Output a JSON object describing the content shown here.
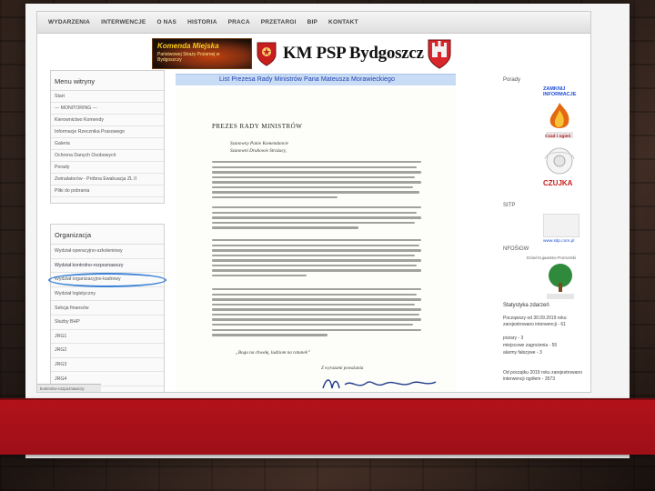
{
  "topnav": {
    "items": [
      "WYDARZENIA",
      "INTERWENCJE",
      "O NAS",
      "HISTORIA",
      "PRACA",
      "PRZETARGI",
      "BIP",
      "KONTAKT"
    ]
  },
  "banner": {
    "box_title": "Komenda Miejska",
    "box_sub": "Państwowej Straży Pożarnej w Bydgoszczy",
    "title": "KM PSP Bydgoszcz"
  },
  "menu": {
    "title": "Menu witryny",
    "items": [
      "Start",
      "--- MONITORING ---",
      "Kierownictwo Komendy",
      "Informacje Rzecznika Prasowego",
      "Galeria",
      "Ochrona Danych Osobowych",
      "Porady",
      "Zwinalatorów - Próbna Ewakuacja ZL II",
      "Pliki do pobrania"
    ]
  },
  "org": {
    "title": "Organizacja",
    "items": [
      "Wydział operacyjno-szkoleniowy",
      "Wydział kontrolno-rozpoznawczy",
      "Wydział organizacyjno-kadrowy",
      "Wydział logistyczny",
      "Sekcja finansów",
      "Służby BHP",
      "JRG1",
      "JRG2",
      "JRG3",
      "JRG4"
    ],
    "status": "kontrolno-rozpoznawczy"
  },
  "document": {
    "heading": "List Prezesa Rady Ministrów Pana Mateusza Morawieckiego",
    "letter_title": "PREZES RADY MINISTRÓW",
    "greeting1": "Szanowny Panie Komendancie",
    "greeting2": "Szanowni Druhowie Strażacy,",
    "closing_quote": "„Bogu na chwałę, ludziom na ratunek”",
    "closing": "Z wyrazami poważania"
  },
  "right": {
    "porady": "Porady",
    "zamknij": "ZAMKNIJ INFORMACJE",
    "czad_label": "Czad i ogień",
    "czujka_label": "CZUJKA",
    "sitp": "SITP",
    "sitp_link": "www.sitp.com.pl",
    "sitp_region": "Dział Kujawsko-Pomorski",
    "nfosigw": "NFOŚiGW",
    "stats_title": "Statystyka zdarzeń",
    "stats1": "Począwszy od 30.09.2019 roku zarejestrowano interwencji - 61",
    "stats2a": "pożary - 3",
    "stats2b": "miejscowe zagrożenia - 55",
    "stats2c": "alarmy fałszywe - 3",
    "stats3": "Od początku 2019 roku zarejestrowano interwencji ogółem - 3573"
  },
  "colors": {
    "accent_red": "#b3121b",
    "link_blue": "#1d4ed8",
    "doc_bar": "#c9dcf5",
    "highlight_oval": "#3b82d6"
  }
}
